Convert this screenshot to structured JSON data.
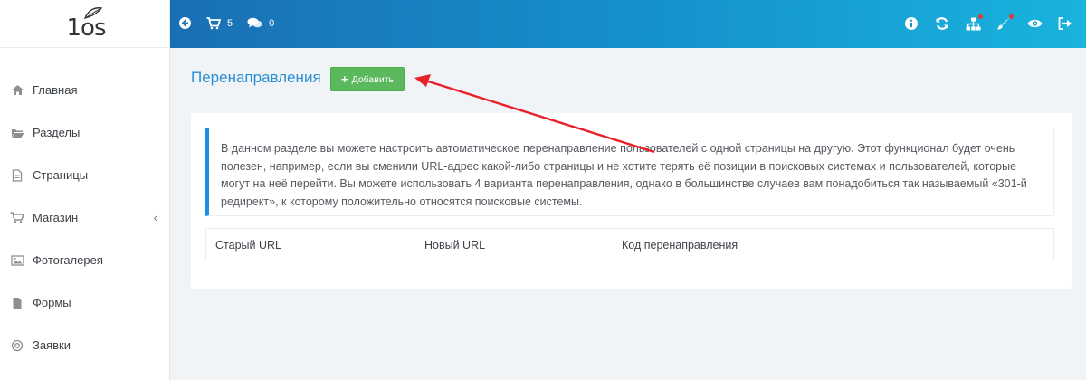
{
  "logo": {
    "text": "1os"
  },
  "sidebar": {
    "items": [
      {
        "label": "Главная",
        "icon": "home-icon"
      },
      {
        "label": "Разделы",
        "icon": "folder-icon"
      },
      {
        "label": "Страницы",
        "icon": "file-icon"
      },
      {
        "label": "Магазин",
        "icon": "cart-icon",
        "has_submenu": true
      },
      {
        "label": "Фотогалерея",
        "icon": "image-icon"
      },
      {
        "label": "Формы",
        "icon": "file-icon"
      },
      {
        "label": "Заявки",
        "icon": "target-icon"
      }
    ]
  },
  "topbar": {
    "cart_count": "5",
    "messages_count": "0",
    "right_icons": [
      "info-icon",
      "refresh-icon",
      "sitemap-icon",
      "brush-icon",
      "eye-icon",
      "sign-out-icon"
    ]
  },
  "main": {
    "title": "Перенаправления",
    "add_button": "Добавить",
    "info_text": "В данном разделе вы можете настроить автоматическое перенаправление пользователей с одной страницы на другую. Этот функционал будет очень полезен, например, если вы сменили URL-адрес какой-либо страницы и не хотите терять её позиции в поисковых системах и пользователей, которые могут на неё перейти. Вы можете использовать 4 варианта перенаправления, однако в большинстве случаев вам понадобиться так называемый «301-й редирект», к которому положительно относятся поисковые системы.",
    "table": {
      "columns": [
        "Старый URL",
        "Новый URL",
        "Код перенаправления"
      ]
    }
  },
  "colors": {
    "topbar_start": "#1a6fb4",
    "topbar_end": "#19b3dd",
    "title": "#2b8fd6",
    "add_button": "#5cb85c",
    "callout_border": "#1a8fe6",
    "annotation_arrow": "#e8202a"
  }
}
